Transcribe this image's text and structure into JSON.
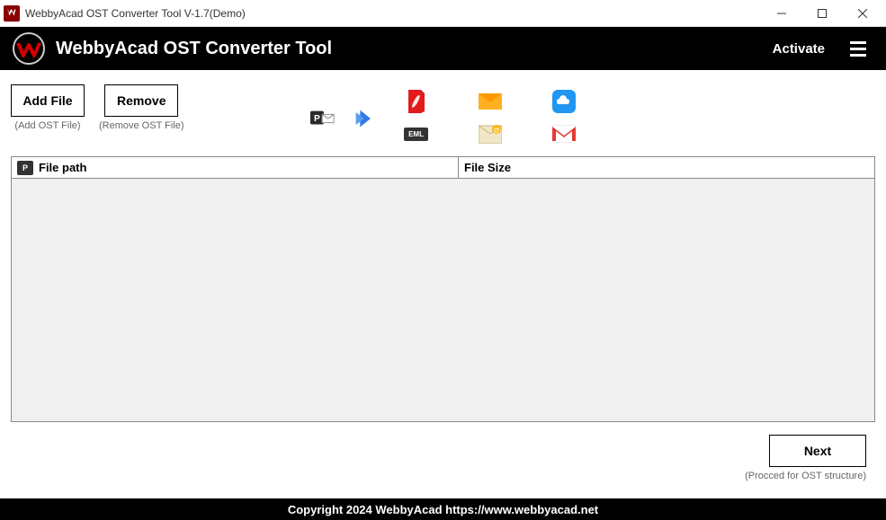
{
  "titlebar": {
    "text": "WebbyAcad OST Converter Tool V-1.7(Demo)"
  },
  "header": {
    "title": "WebbyAcad OST Converter Tool",
    "activate": "Activate"
  },
  "toolbar": {
    "add_file": {
      "label": "Add File",
      "caption": "(Add OST File)"
    },
    "remove": {
      "label": "Remove",
      "caption": "(Remove OST File)"
    }
  },
  "icons": {
    "eml_label": "EML"
  },
  "table": {
    "col1": "File path",
    "col2": "File Size"
  },
  "footer": {
    "next": "Next",
    "caption": "(Procced for OST structure)"
  },
  "copyright": "Copyright 2024 WebbyAcad https://www.webbyacad.net"
}
